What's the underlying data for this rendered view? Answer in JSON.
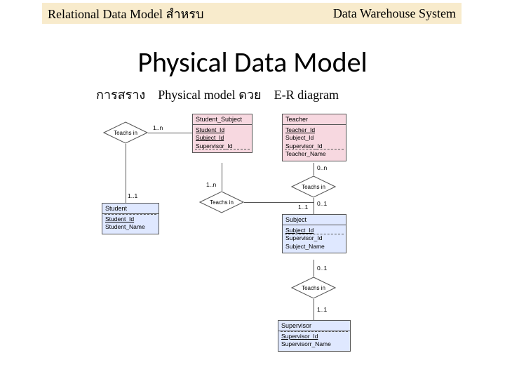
{
  "banner": {
    "left": "Relational Data Model สำหรบ",
    "right": "Data Warehouse System"
  },
  "main_title": "Physical Data Model",
  "subtitle_parts": {
    "a": "การสราง",
    "b": "Physical model ดวย",
    "c": "E-R diagram"
  },
  "entities": {
    "student_subject": {
      "title": "Student_Subject",
      "fields": [
        "Student_Id",
        "Subject_Id",
        "Supervisor_Id"
      ],
      "pk_count": 2
    },
    "teacher": {
      "title": "Teacher",
      "fields": [
        "Teacher_Id",
        "Subject_Id",
        "Supervisor_Id",
        "Teacher_Name"
      ],
      "pk_count": 1
    },
    "student": {
      "title": "Student",
      "fields": [
        "Student_Id",
        "Student_Name"
      ],
      "pk_count": 1
    },
    "subject": {
      "title": "Subject",
      "fields": [
        "Subject_Id",
        "Supervisor_Id",
        "Subject_Name"
      ],
      "pk_count": 1
    },
    "supervisor": {
      "title": "Supervisor",
      "fields": [
        "Supervisor_Id",
        "Supervisorr_Name"
      ],
      "pk_count": 1
    }
  },
  "rel_label": "Teachs in",
  "cards": {
    "one_one": "1..1",
    "one_n": "1..n",
    "zero_n": "0..n",
    "zero_one": "0..1"
  }
}
